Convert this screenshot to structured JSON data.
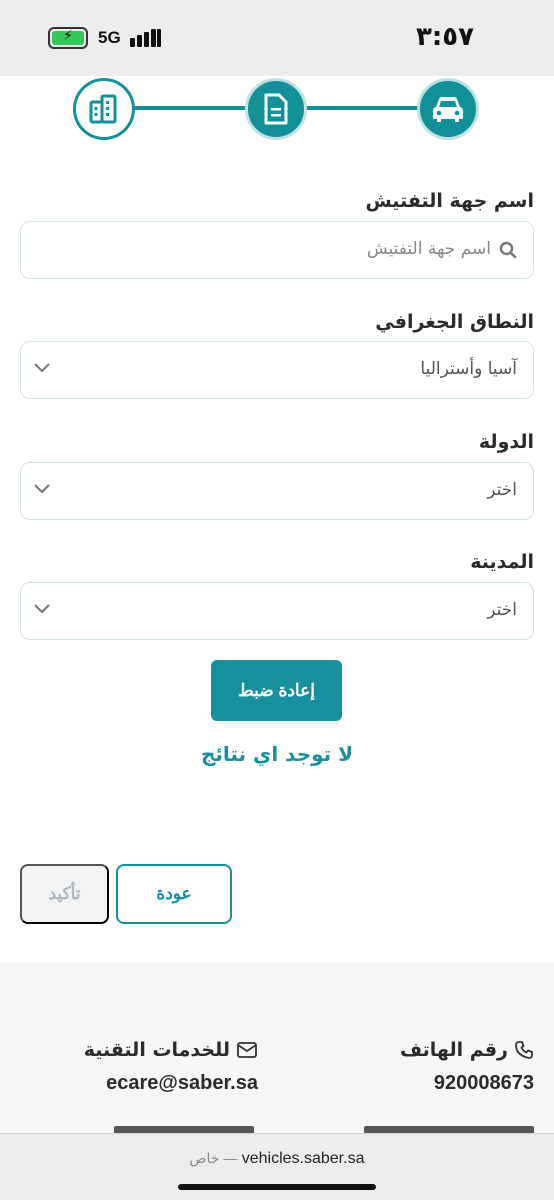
{
  "status": {
    "time": "٣:٥٧",
    "network": "5G"
  },
  "stepper": {
    "steps": [
      {
        "icon": "car-icon",
        "state": "active"
      },
      {
        "icon": "document-icon",
        "state": "active"
      },
      {
        "icon": "building-icon",
        "state": "inactive"
      }
    ]
  },
  "form": {
    "inspection_label": "اسم جهة التفتيش",
    "inspection_placeholder": "اسم جهة التفتيش",
    "region_label": "النطاق الجغرافي",
    "region_value": "آسيا وأستراليا",
    "country_label": "الدولة",
    "country_value": "اختر",
    "city_label": "المدينة",
    "city_value": "اختر",
    "reset_label": "إعادة ضبط",
    "no_results": "لا توجد اي نتائج"
  },
  "actions": {
    "confirm_label": "تأكيد",
    "back_label": "عودة"
  },
  "footer": {
    "phone_title": "رقم الهاتف",
    "phone_value": "920008673",
    "tech_title": "للخدمات التقنية",
    "tech_email": "ecare@saber.sa"
  },
  "browser": {
    "url": "vehicles.saber.sa",
    "private_label": "خاص —"
  },
  "colors": {
    "primary": "#16909d",
    "step_border": "#bfe2e5",
    "field_border": "#cfe3e4",
    "footer_bg": "#f4f6f7"
  }
}
